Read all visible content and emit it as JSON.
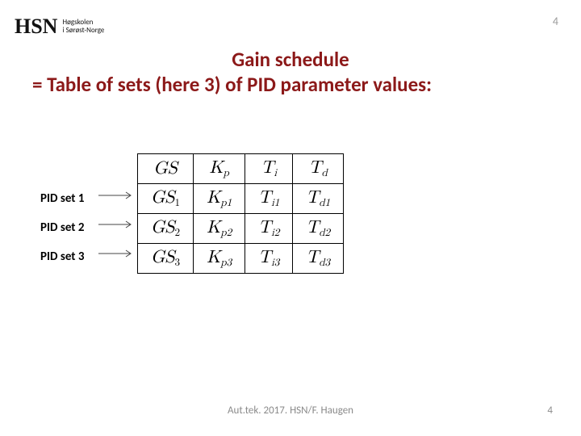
{
  "logo": {
    "mark": "HSN",
    "line1": "Høgskolen",
    "line2": "i Sørøst-Norge"
  },
  "page_top": "4",
  "title": {
    "line1": "Gain schedule",
    "line2": "= Table of sets (here 3) of PID parameter values:"
  },
  "row_labels": [
    "PID set 1",
    "PID set 2",
    "PID set 3"
  ],
  "table": {
    "header": {
      "gs": "GS",
      "kp": "K",
      "kp_sub": "p",
      "ti": "T",
      "ti_sub": "i",
      "td": "T",
      "td_sub": "d"
    },
    "rows": [
      {
        "gs": "GS",
        "gs_sub": "1",
        "kp": "K",
        "kp_sub": "p1",
        "ti": "T",
        "ti_sub": "i1",
        "td": "T",
        "td_sub": "d1"
      },
      {
        "gs": "GS",
        "gs_sub": "2",
        "kp": "K",
        "kp_sub": "p2",
        "ti": "T",
        "ti_sub": "i2",
        "td": "T",
        "td_sub": "d2"
      },
      {
        "gs": "GS",
        "gs_sub": "3",
        "kp": "K",
        "kp_sub": "p3",
        "ti": "T",
        "ti_sub": "i3",
        "td": "T",
        "td_sub": "d3"
      }
    ]
  },
  "footer": "Aut.tek. 2017. HSN/F. Haugen",
  "page_bottom": "4"
}
